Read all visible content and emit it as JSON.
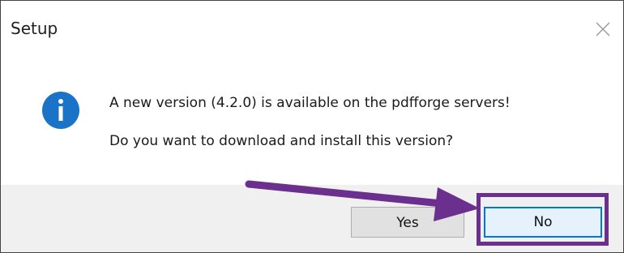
{
  "dialog": {
    "title": "Setup",
    "close_icon": "close-icon",
    "info_icon": "info-icon",
    "message_line1": "A new version (4.2.0) is available on the pdfforge servers!",
    "message_line2": "Do you want to download and install this version?"
  },
  "buttons": {
    "yes_label": "Yes",
    "no_label": "No"
  },
  "annotation": {
    "arrow_icon": "arrow-icon",
    "highlight_color": "#6b2f8e"
  },
  "colors": {
    "info_blue": "#1a73c7",
    "accent_focus": "#0078d7"
  }
}
